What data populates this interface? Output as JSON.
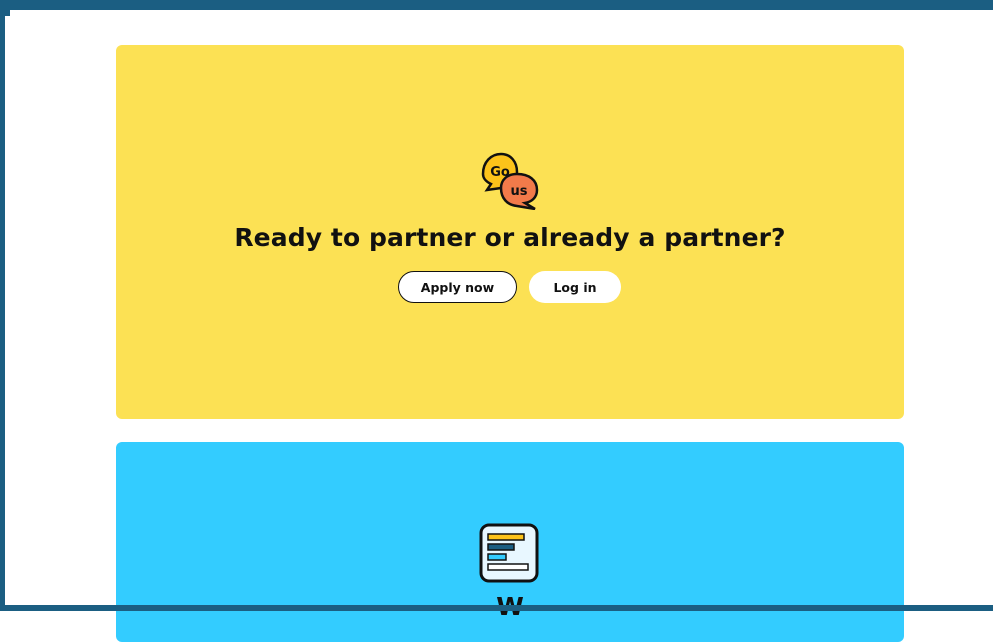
{
  "partner_card": {
    "icon": "go-us-chat-bubbles-icon",
    "icon_text_top": "Go",
    "icon_text_bottom": "us",
    "headline": "Ready to partner or already a partner?",
    "apply_label": "Apply now",
    "login_label": "Log in",
    "background": "#fce154"
  },
  "next_card": {
    "icon": "data-chart-icon",
    "headline": "W",
    "background": "#33ccff"
  },
  "colors": {
    "frame": "#1b5e82",
    "orange_bubble": "#f27a4a",
    "yellow_bubble": "#fcc31a"
  }
}
